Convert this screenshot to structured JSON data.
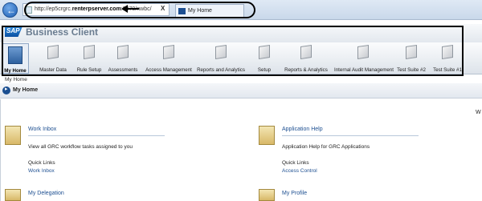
{
  "browser": {
    "url_prefix": "http://ep5crgrc.",
    "url_domain": "renterpserver.com",
    "url_suffix": ":8070/nwbc/",
    "tab_title": "My Home",
    "close_glyph": "X"
  },
  "header": {
    "logo_text": "SAP",
    "app_title": "Business Client"
  },
  "nav": {
    "items": [
      {
        "label": "My Home"
      },
      {
        "label": "Master Data"
      },
      {
        "label": "Rule Setup"
      },
      {
        "label": "Assessments"
      },
      {
        "label": "Access Management"
      },
      {
        "label": "Reports and Analytics"
      },
      {
        "label": "Setup"
      },
      {
        "label": "Reports & Analytics"
      },
      {
        "label": "Internal Audit Management"
      },
      {
        "label": "Test Suite #2"
      },
      {
        "label": "Test Suite #1"
      }
    ]
  },
  "breadcrumb": "My Home",
  "page_header": {
    "title": "My Home",
    "trailing": "W"
  },
  "panels": {
    "work_inbox": {
      "title": "Work Inbox",
      "description": "View all GRC workflow tasks assigned to you",
      "quick_links_label": "Quick Links",
      "link": "Work Inbox"
    },
    "application_help": {
      "title": "Application Help",
      "description": "Application Help for GRC Applications",
      "quick_links_label": "Quick Links",
      "link": "Access Control"
    },
    "my_delegation": {
      "title": "My Delegation"
    },
    "my_profile": {
      "title": "My Profile"
    }
  },
  "colors": {
    "link": "#1d4f91",
    "annotation": "#000000"
  }
}
